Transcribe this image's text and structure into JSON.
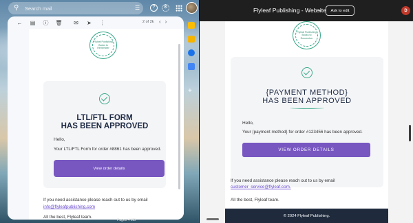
{
  "gmail": {
    "search_placeholder": "Search mail",
    "pager": "2 of 2k",
    "email": {
      "logo_text": "Flyleaf Publishing\nBooks to Remember",
      "title_line1": "LTL/FTL FORM",
      "title_line2": "HAS BEEN APPROVED",
      "greeting": "Hello,",
      "message": "Your LTL/FTL Form for order #8861 has been approved.",
      "button_label": "View order details",
      "help_text": "If you need assistance please reach out to us by email",
      "help_email": "info@flyleafpublishing.com",
      "signoff": "All the best, Flyleaf team."
    },
    "bottom_fragment": "Pages 4 MB"
  },
  "website": {
    "title": "Flyleaf Publishing - Website",
    "ask_to_edit": "Ask to edit",
    "avatar_letter": "D",
    "email": {
      "logo_text": "Flyleaf Publishing\nBooks to Remember",
      "title_line1": "{PAYMENT METHOD}",
      "title_line2": "HAS BEEN APPROVED",
      "greeting": "Hello,",
      "message": "Your {payment method} for order #123456 has been approved.",
      "button_label": "VIEW ORDER DETAILS",
      "help_text": "If you need assistance please reach out to us by email",
      "help_email": "customer_service@flyleaf.com.",
      "signoff": "All the best, Flyleaf team.",
      "footer": "© 2024 Flyleaf Publishing."
    }
  },
  "colors": {
    "accent_purple": "#7857c1",
    "brand_green": "#37a788",
    "footer_navy": "#1f2b3d",
    "avatar_red": "#c0392b"
  },
  "icons": [
    "search-icon",
    "tune-icon",
    "help-icon",
    "settings-icon",
    "apps-grid-icon",
    "back-arrow-icon",
    "archive-icon",
    "report-icon",
    "delete-icon",
    "mark-unread-icon",
    "move-to-icon",
    "more-icon",
    "chevron-left-icon",
    "chevron-right-icon",
    "check-circle-icon",
    "chevron-down-icon"
  ]
}
